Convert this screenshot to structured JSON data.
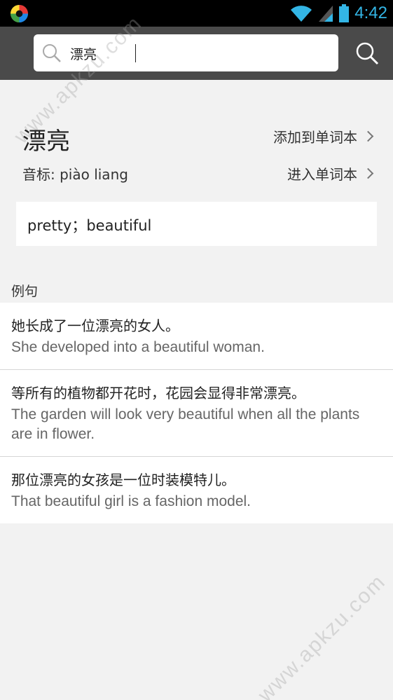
{
  "status_bar": {
    "time": "4:42"
  },
  "search": {
    "query": "漂亮"
  },
  "entry": {
    "word": "漂亮",
    "add_label": "添加到单词本",
    "phonetic": "音标: piào liang",
    "enter_label": "进入单词本",
    "definition": "pretty；beautiful"
  },
  "examples": {
    "header": "例句",
    "items": [
      {
        "zh": "她长成了一位漂亮的女人。",
        "en": "She developed into a beautiful woman."
      },
      {
        "zh": "等所有的植物都开花时，花园会显得非常漂亮。",
        "en": "The garden will look very beautiful when all the plants are in flower."
      },
      {
        "zh": "那位漂亮的女孩是一位时装模特儿。",
        "en": "That beautiful girl is a fashion model."
      }
    ]
  },
  "watermark": "www.apkzu.com",
  "colors": {
    "status_accent": "#33b5e5",
    "search_bar": "#4a4a4a",
    "background": "#f2f2f2"
  }
}
